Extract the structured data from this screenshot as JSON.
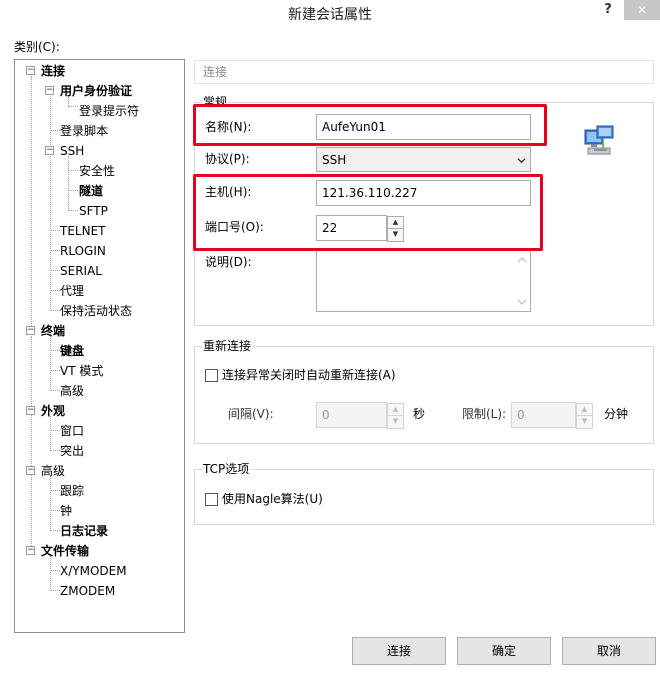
{
  "window": {
    "title": "新建会话属性",
    "help_label": "?",
    "close_label": "✕"
  },
  "category_label": "类别(C):",
  "tree": {
    "items": [
      {
        "label": "连接",
        "bold": true
      },
      {
        "label": "用户身份验证",
        "bold": true
      },
      {
        "label": "登录提示符",
        "bold": false
      },
      {
        "label": "登录脚本",
        "bold": false
      },
      {
        "label": "SSH",
        "bold": false
      },
      {
        "label": "安全性",
        "bold": false
      },
      {
        "label": "隧道",
        "bold": true
      },
      {
        "label": "SFTP",
        "bold": false
      },
      {
        "label": "TELNET",
        "bold": false
      },
      {
        "label": "RLOGIN",
        "bold": false
      },
      {
        "label": "SERIAL",
        "bold": false
      },
      {
        "label": "代理",
        "bold": false
      },
      {
        "label": "保持活动状态",
        "bold": false
      },
      {
        "label": "终端",
        "bold": true
      },
      {
        "label": "键盘",
        "bold": true
      },
      {
        "label": "VT 模式",
        "bold": false
      },
      {
        "label": "高级",
        "bold": false
      },
      {
        "label": "外观",
        "bold": true
      },
      {
        "label": "窗口",
        "bold": false
      },
      {
        "label": "突出",
        "bold": false
      },
      {
        "label": "高级",
        "bold": false
      },
      {
        "label": "跟踪",
        "bold": false
      },
      {
        "label": "钟",
        "bold": false
      },
      {
        "label": "日志记录",
        "bold": true
      },
      {
        "label": "文件传输",
        "bold": true
      },
      {
        "label": "X/YMODEM",
        "bold": false
      },
      {
        "label": "ZMODEM",
        "bold": false
      }
    ],
    "expander_collapse": "−"
  },
  "breadcrumb": "连接",
  "general": {
    "legend": "常规",
    "name_label": "名称(N):",
    "name_value": "AufeYun01",
    "protocol_label": "协议(P):",
    "protocol_value": "SSH",
    "host_label": "主机(H):",
    "host_value": "121.36.110.227",
    "port_label": "端口号(O):",
    "port_value": "22",
    "desc_label": "说明(D):",
    "desc_value": ""
  },
  "reconnect": {
    "legend": "重新连接",
    "checkbox_label": "连接异常关闭时自动重新连接(A)",
    "checked": false,
    "interval_label": "间隔(V):",
    "interval_value": "0",
    "interval_unit": "秒",
    "limit_label": "限制(L):",
    "limit_value": "0",
    "limit_unit": "分钟"
  },
  "tcp": {
    "legend": "TCP选项",
    "nagle_label": "使用Nagle算法(U)",
    "checked": false
  },
  "buttons": {
    "connect": "连接",
    "ok": "确定",
    "cancel": "取消"
  },
  "icons": {
    "computer": "network-computer-icon",
    "select_arrow": "chevron-down-icon",
    "spin_up": "spin-up-icon",
    "spin_down": "spin-down-icon"
  },
  "colors": {
    "highlight": "#e8001e",
    "background": "#ffffff",
    "button": "#e5e5e5"
  }
}
